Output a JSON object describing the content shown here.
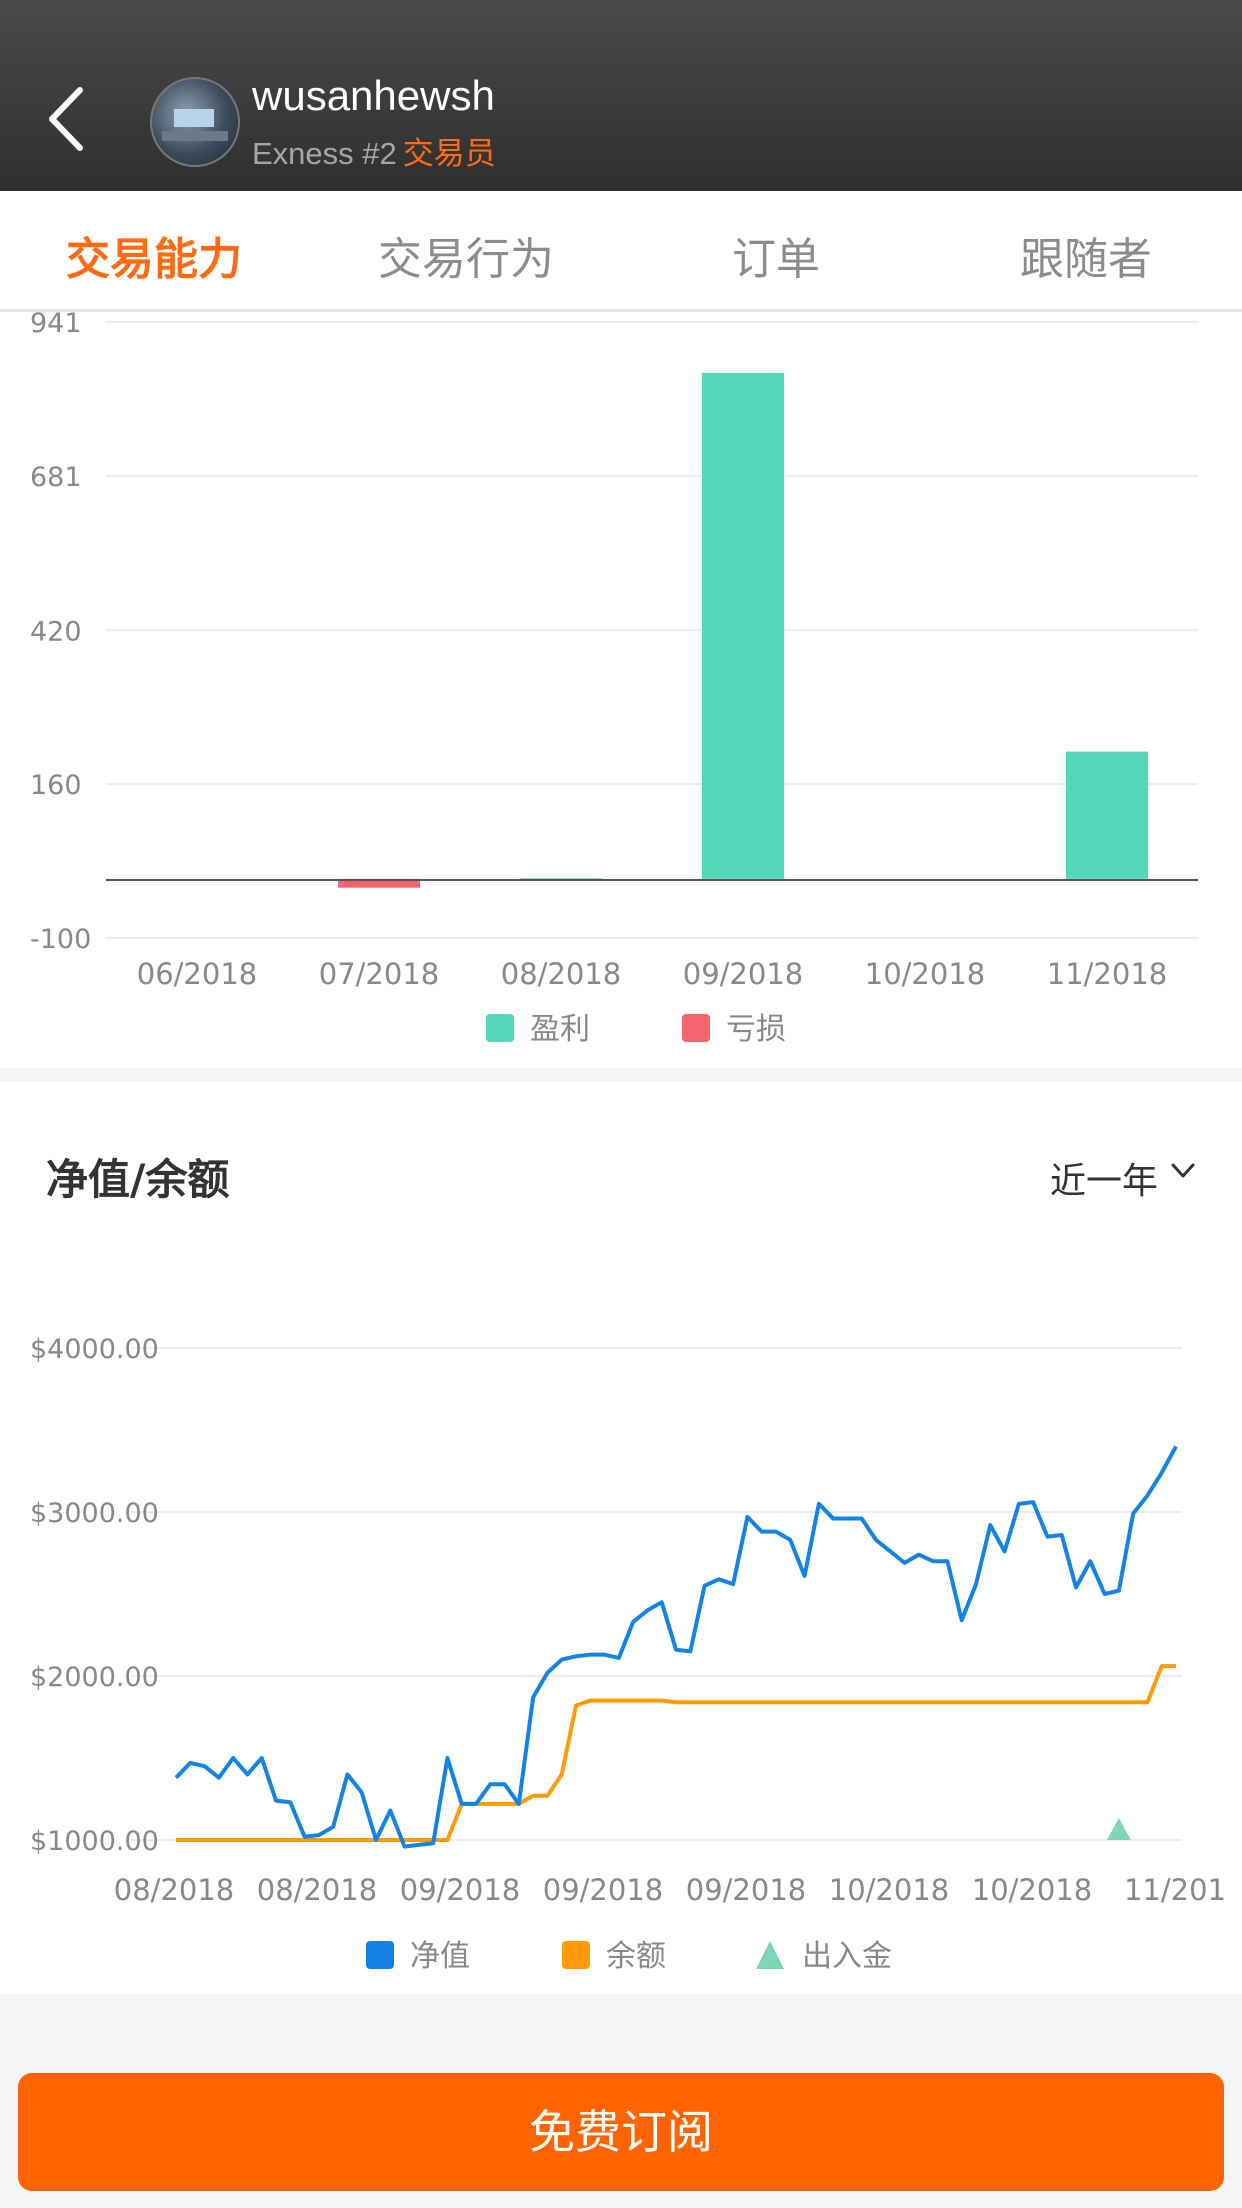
{
  "header": {
    "username": "wusanhewsh",
    "broker": "Exness #2",
    "role": "交易员"
  },
  "tabs": [
    {
      "label": "交易能力",
      "active": true
    },
    {
      "label": "交易行为",
      "active": false
    },
    {
      "label": "订单",
      "active": false
    },
    {
      "label": "跟随者",
      "active": false
    }
  ],
  "profit_chart": {
    "legend_profit": "盈利",
    "legend_loss": "亏损",
    "colors": {
      "profit": "#52d8b8",
      "loss": "#f56470"
    }
  },
  "equity_section": {
    "title": "净值/余额",
    "period": "近一年",
    "legend_equity": "净值",
    "legend_balance": "余额",
    "legend_deposit": "出入金",
    "colors": {
      "equity": "#1383e6",
      "balance": "#ff9a0a",
      "deposit": "#7ed6b5"
    }
  },
  "cta": {
    "label": "免费订阅"
  },
  "chart_data": [
    {
      "type": "bar",
      "categories": [
        "06/2018",
        "07/2018",
        "08/2018",
        "09/2018",
        "10/2018",
        "11/2018"
      ],
      "series": [
        {
          "name": "盈利",
          "values": [
            0,
            0,
            1,
            855,
            0,
            215
          ]
        },
        {
          "name": "亏损",
          "values": [
            0,
            -15,
            0,
            0,
            0,
            0
          ]
        }
      ],
      "yticks": [
        "941",
        "681",
        "420",
        "160",
        "-100"
      ],
      "ylim": [
        -100,
        941
      ],
      "grid": true,
      "legend": "bottom-center"
    },
    {
      "type": "line",
      "xticks": [
        "08/2018",
        "08/2018",
        "09/2018",
        "09/2018",
        "09/2018",
        "10/2018",
        "10/2018",
        "11/201"
      ],
      "yticks": [
        "$4000.00",
        "$3000.00",
        "$2000.00",
        "$1000.00"
      ],
      "ylim": [
        1000,
        4000
      ],
      "series": [
        {
          "name": "净值",
          "values": [
            1380,
            1470,
            1450,
            1380,
            1500,
            1400,
            1500,
            1240,
            1230,
            1020,
            1030,
            1080,
            1400,
            1290,
            1000,
            1180,
            960,
            970,
            980,
            1500,
            1220,
            1220,
            1340,
            1340,
            1220,
            1870,
            2020,
            2100,
            2120,
            2130,
            2130,
            2110,
            2330,
            2400,
            2450,
            2160,
            2150,
            2550,
            2590,
            2560,
            2970,
            2880,
            2880,
            2830,
            2610,
            3050,
            2960,
            2960,
            2960,
            2830,
            2760,
            2690,
            2740,
            2700,
            2700,
            2340,
            2560,
            2920,
            2760,
            3050,
            3060,
            2850,
            2860,
            2540,
            2700,
            2500,
            2520,
            2990,
            3100,
            3240,
            3400
          ]
        },
        {
          "name": "余额",
          "values": [
            1000,
            1000,
            1000,
            1000,
            1000,
            1000,
            1000,
            1000,
            1000,
            1000,
            1000,
            1000,
            1000,
            1000,
            1000,
            1000,
            1000,
            1000,
            1000,
            1000,
            1220,
            1220,
            1220,
            1220,
            1220,
            1270,
            1270,
            1400,
            1820,
            1850,
            1850,
            1850,
            1850,
            1850,
            1850,
            1840,
            1840,
            1840,
            1840,
            1840,
            1840,
            1840,
            1840,
            1840,
            1840,
            1840,
            1840,
            1840,
            1840,
            1840,
            1840,
            1840,
            1840,
            1840,
            1840,
            1840,
            1840,
            1840,
            1840,
            1840,
            1840,
            1840,
            1840,
            1840,
            1840,
            1840,
            1840,
            1840,
            1840,
            2060,
            2060
          ]
        }
      ],
      "deposit_markers": [
        {
          "index": 66,
          "value": 1000
        }
      ],
      "grid": true,
      "legend": "bottom-center"
    }
  ]
}
